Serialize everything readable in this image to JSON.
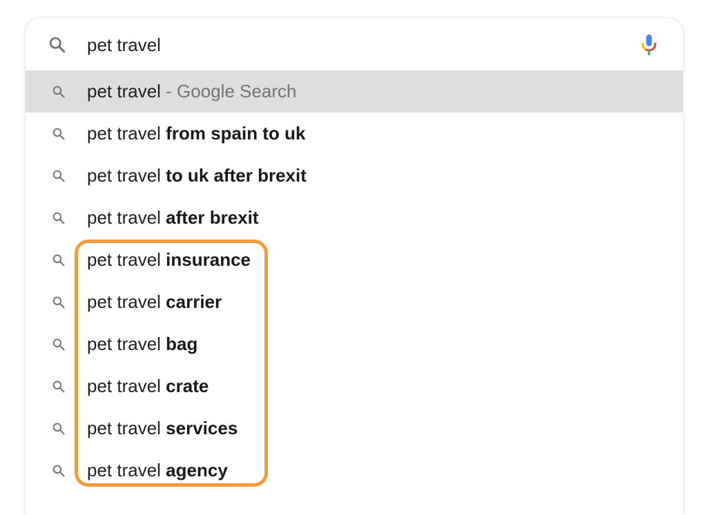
{
  "search": {
    "query": "pet travel"
  },
  "suggestions": [
    {
      "prefix": "pet travel",
      "bold": "",
      "suffix": " - Google Search",
      "highlighted": true
    },
    {
      "prefix": "pet travel ",
      "bold": "from spain to uk",
      "suffix": ""
    },
    {
      "prefix": "pet travel ",
      "bold": "to uk after brexit",
      "suffix": ""
    },
    {
      "prefix": "pet travel ",
      "bold": "after brexit",
      "suffix": ""
    },
    {
      "prefix": "pet travel ",
      "bold": "insurance",
      "suffix": ""
    },
    {
      "prefix": "pet travel ",
      "bold": "carrier",
      "suffix": ""
    },
    {
      "prefix": "pet travel ",
      "bold": "bag",
      "suffix": ""
    },
    {
      "prefix": "pet travel ",
      "bold": "crate",
      "suffix": ""
    },
    {
      "prefix": "pet travel ",
      "bold": "services",
      "suffix": ""
    },
    {
      "prefix": "pet travel ",
      "bold": "agency",
      "suffix": ""
    }
  ],
  "icons": {
    "search": "search-icon",
    "mic": "microphone-icon"
  },
  "colors": {
    "highlight_row": "#dedede",
    "callout_border": "#f29b38",
    "mic_blue": "#4285f4",
    "mic_red": "#ea4335",
    "mic_yellow": "#fbbc05",
    "mic_green": "#34a853"
  }
}
